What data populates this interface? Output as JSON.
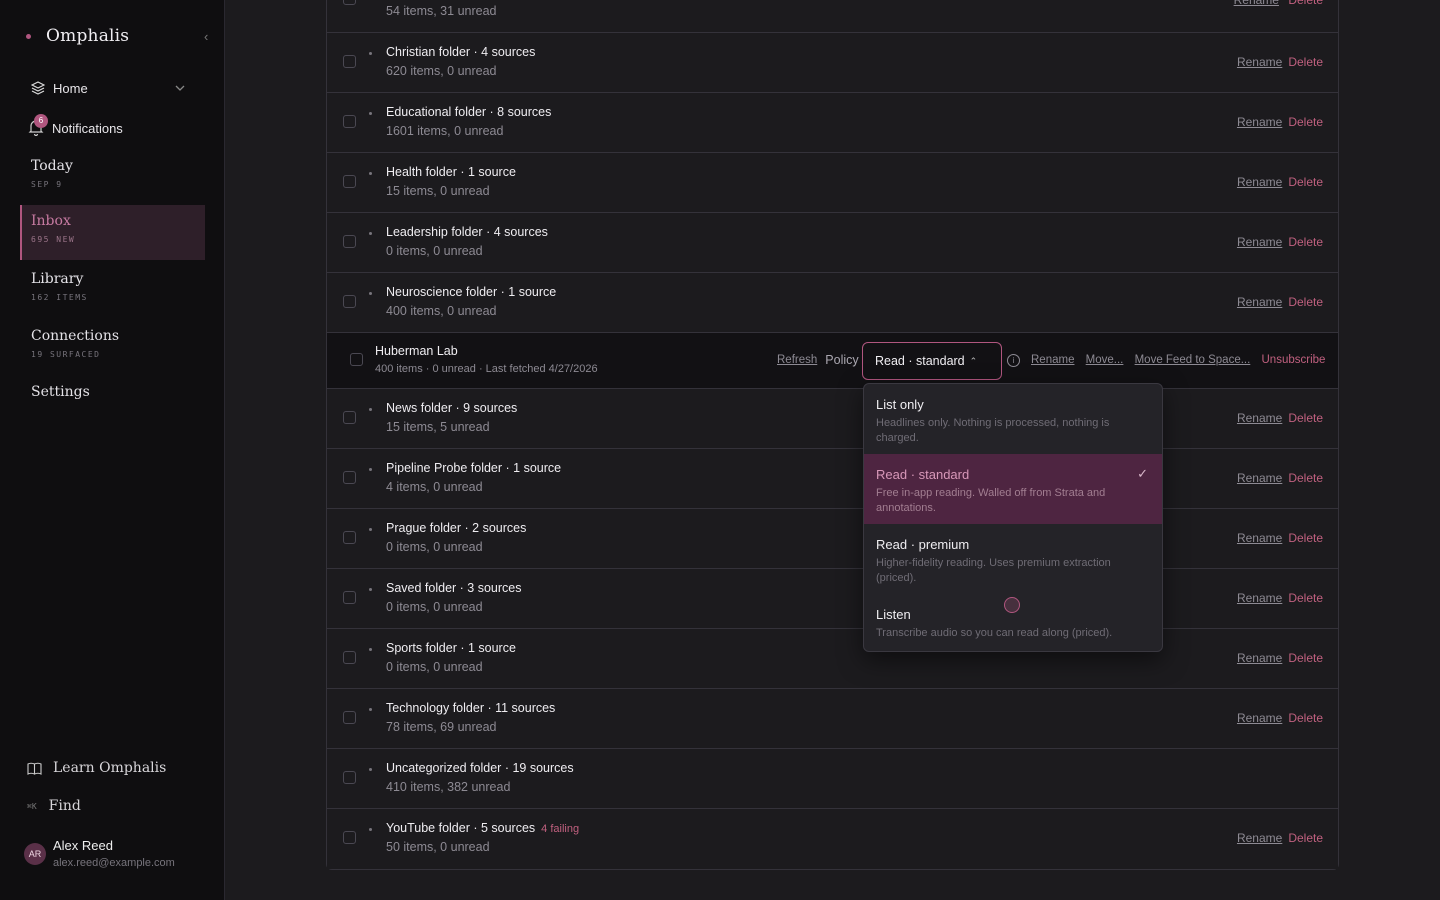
{
  "app": {
    "name": "Omphalis",
    "collapse_glyph": "‹"
  },
  "nav": {
    "home": "Home",
    "notifications": {
      "label": "Notifications",
      "count": "6"
    },
    "blocks": [
      {
        "title": "Today",
        "sub": "SEP 9"
      },
      {
        "title": "Inbox",
        "sub": "695 NEW"
      },
      {
        "title": "Library",
        "sub": "162 ITEMS"
      },
      {
        "title": "Connections",
        "sub": "19 SURFACED"
      }
    ],
    "settings": "Settings",
    "learn": "Learn Omphalis",
    "find": {
      "shortcut": "⌘K",
      "label": "Find"
    },
    "user": {
      "initials": "AR",
      "name": "Alex Reed",
      "email": "alex.reed@example.com"
    }
  },
  "actions": {
    "rename": "Rename",
    "delete": "Delete"
  },
  "folders_top": [
    {
      "title": "",
      "sub": "54 items, 31 unread"
    },
    {
      "title": "Christian folder · 4 sources",
      "sub": "620 items, 0 unread"
    },
    {
      "title": "Educational folder · 8 sources",
      "sub": "1601 items, 0 unread"
    },
    {
      "title": "Health folder · 1 source",
      "sub": "15 items, 0 unread"
    },
    {
      "title": "Leadership folder · 4 sources",
      "sub": "0 items, 0 unread"
    },
    {
      "title": "Neuroscience folder · 1 source",
      "sub": "400 items, 0 unread"
    }
  ],
  "expanded_feed": {
    "title": "Huberman Lab",
    "sub": "400 items · 0 unread · Last fetched 4/27/2026",
    "refresh": "Refresh",
    "policy_label": "Policy",
    "policy_value": "Read · standard",
    "rename": "Rename",
    "move": "Move...",
    "move_space": "Move Feed to Space...",
    "unsubscribe": "Unsubscribe"
  },
  "folders_bottom": [
    {
      "title": "News folder · 9 sources",
      "sub": "15 items, 5 unread",
      "actions": true
    },
    {
      "title": "Pipeline Probe folder · 1 source",
      "sub": "4 items, 0 unread",
      "actions": true
    },
    {
      "title": "Prague folder · 2 sources",
      "sub": "0 items, 0 unread",
      "actions": true
    },
    {
      "title": "Saved folder · 3 sources",
      "sub": "0 items, 0 unread",
      "actions": true
    },
    {
      "title": "Sports folder · 1 source",
      "sub": "0 items, 0 unread",
      "actions": true
    },
    {
      "title": "Technology folder · 11 sources",
      "sub": "78 items, 69 unread",
      "actions": true
    },
    {
      "title": "Uncategorized folder · 19 sources",
      "sub": "410 items, 382 unread",
      "actions": false
    },
    {
      "title": "YouTube folder · 5 sources",
      "sub": "50 items, 0 unread",
      "actions": true,
      "failing": "4 failing"
    }
  ],
  "policy_options": [
    {
      "title": "List only",
      "desc": "Headlines only. Nothing is processed, nothing is charged.",
      "selected": false
    },
    {
      "title": "Read · standard",
      "desc": "Free in-app reading. Walled off from Strata and annotations.",
      "selected": true
    },
    {
      "title": "Read · premium",
      "desc": "Higher-fidelity reading. Uses premium extraction (priced).",
      "selected": false
    },
    {
      "title": "Listen",
      "desc": "Transcribe audio so you can read along (priced).",
      "selected": false
    }
  ],
  "colors": {
    "accent": "#b0567f",
    "danger": "#c0607f",
    "selected_bg": "#4e2541"
  }
}
